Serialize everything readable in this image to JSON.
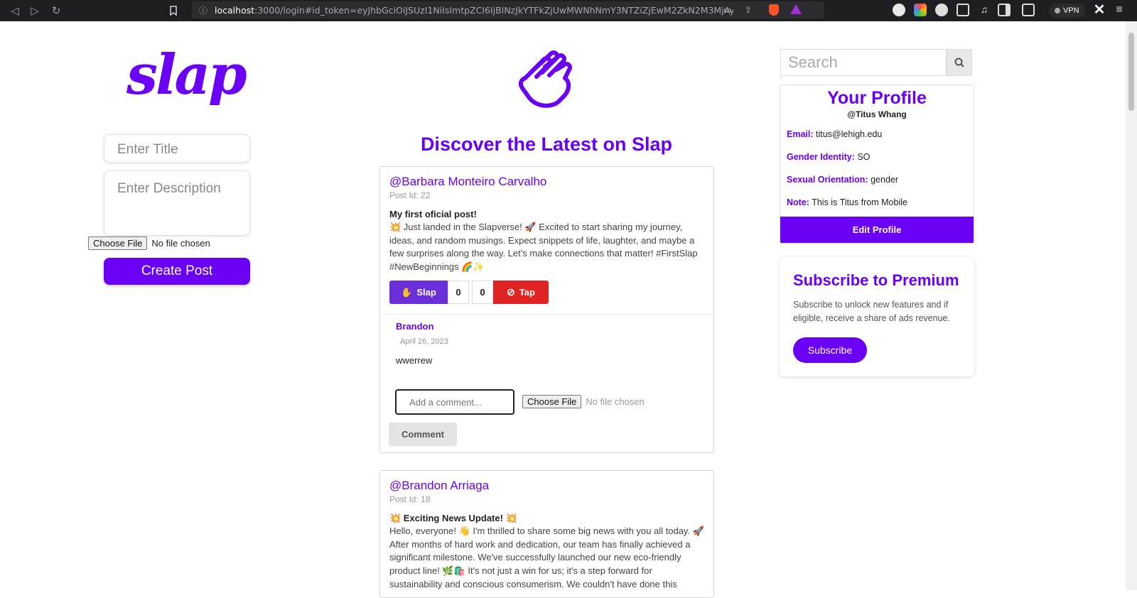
{
  "browser": {
    "url_host": "localhost",
    "url_rest": ":3000/login#id_token=eyJhbGciOiJSUzI1NiIsImtpZCI6IjBlNzJkYTFkZjUwMWNhNmY3NTZiZjEwM2ZkN2M3MjAyOT...",
    "vpn_label": "VPN"
  },
  "composer": {
    "logo_text": "slap",
    "title_placeholder": "Enter Title",
    "description_placeholder": "Enter Description",
    "file_button": "Choose File",
    "file_status": "No file chosen",
    "create_label": "Create Post"
  },
  "feed": {
    "heading": "Discover the Latest on Slap",
    "posts": [
      {
        "author": "@Barbara Monteiro Carvalho",
        "post_id": "Post Id: 22",
        "title": "My first oficial post!",
        "body": "💥 Just landed in the Slapverse! 🚀 Excited to start sharing my journey, ideas, and random musings. Expect snippets of life, laughter, and maybe a few surprises along the way. Let's make connections that matter! #FirstSlap #NewBeginnings 🌈✨",
        "slap_label": "Slap",
        "slap_count": "0",
        "tap_count": "0",
        "tap_label": "Tap",
        "comments": [
          {
            "author": "Brandon",
            "date": "April 26, 2023",
            "text": "wwerrew"
          }
        ],
        "comment_placeholder": "Add a comment...",
        "file_button": "Choose File",
        "file_status": "No file chosen",
        "comment_button": "Comment"
      },
      {
        "author": "@Brandon Arriaga",
        "post_id": "Post Id: 18",
        "title": "💥 Exciting News Update! 💥",
        "body": "Hello, everyone! 👋 I'm thrilled to share some big news with you all today. 🚀 After months of hard work and dedication, our team has finally achieved a significant milestone. We've successfully launched our new eco-friendly product line! 🌿🛍️ It's not just a win for us; it's a step forward for sustainability and conscious consumerism. We couldn't have done this"
      }
    ]
  },
  "sidebar": {
    "search_placeholder": "Search",
    "profile": {
      "title": "Your Profile",
      "handle": "@Titus Whang",
      "email_label": "Email:",
      "email": "titus@lehigh.edu",
      "gender_label": "Gender Identity:",
      "gender": "SO",
      "orientation_label": "Sexual Orientation:",
      "orientation": "gender",
      "note_label": "Note:",
      "note": "This is Titus from Mobile",
      "edit_label": "Edit Profile"
    },
    "premium": {
      "title": "Subscribe to Premium",
      "text": "Subscribe to unlock new features and if eligible, receive a share of ads revenue.",
      "button": "Subscribe"
    }
  },
  "colors": {
    "brand": "#6a00f4",
    "slap": "#6a2fd8",
    "tap": "#e02424"
  }
}
